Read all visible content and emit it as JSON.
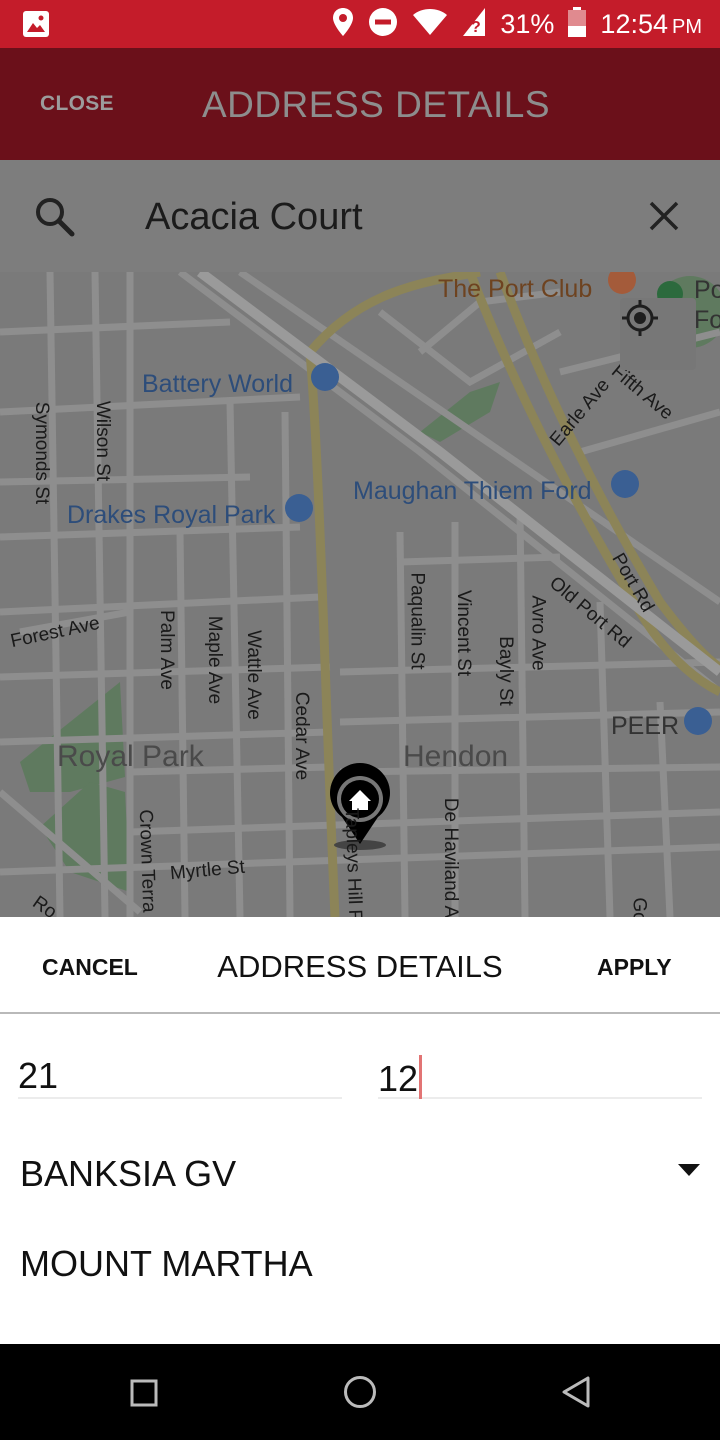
{
  "status_bar": {
    "battery": "31%",
    "time": "12:54",
    "time_suffix": "PM"
  },
  "app_bar": {
    "close_label": "CLOSE",
    "title": "ADDRESS DETAILS"
  },
  "search": {
    "value": "Acacia Court"
  },
  "map": {
    "places": {
      "port_club": "The Port Club",
      "battery_world": "Battery World",
      "drakes": "Drakes Royal Park",
      "maughan": "Maughan Thiem Ford",
      "peer": "PEER",
      "po_fo_1": "Po",
      "po_fo_2": "Fo"
    },
    "areas": {
      "royal_park": "Royal Park",
      "hendon": "Hendon"
    },
    "streets": {
      "symonds": "Symonds St",
      "wilson": "Wilson St",
      "forest": "Forest Ave",
      "palm": "Palm Ave",
      "maple": "Maple Ave",
      "wattle": "Wattle Ave",
      "cedar": "Cedar Ave",
      "paqualin": "Paqualin St",
      "vincent": "Vincent St",
      "bayly": "Bayly St",
      "avro": "Avro Ave",
      "old_port": "Old Port Rd",
      "port_rd": "Port Rd",
      "earle": "Earle Ave",
      "fifth": "Fifth Ave",
      "myrtle": "Myrtle St",
      "crown": "Crown Terra",
      "tapleys": "Tapleys Hill Rd",
      "de_haviland": "De Haviland A",
      "ro": "Ro",
      "go": "Go"
    }
  },
  "sheet": {
    "cancel_label": "CANCEL",
    "title": "ADDRESS DETAILS",
    "apply_label": "APPLY",
    "street_number": "21",
    "unit_number": "12",
    "street_name": "BANKSIA GV",
    "suburb": "MOUNT MARTHA"
  },
  "colors": {
    "status_bar": "#c41c2a",
    "app_bar": "#6b101a",
    "cursor": "#e27474"
  }
}
